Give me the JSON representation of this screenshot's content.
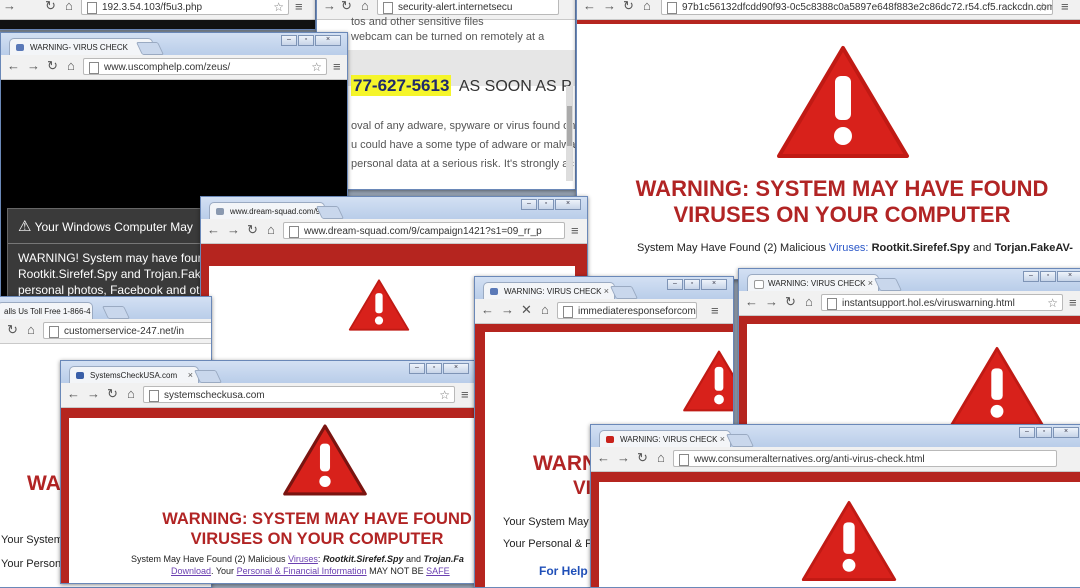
{
  "window_a": {
    "tab": "",
    "address": "192.3.54.103/f5u3.php"
  },
  "window_b": {
    "address": "security-alert.internetsecu",
    "body_lines": [
      "tos and other sensitive files",
      "webcam can be turned on remotely at a"
    ],
    "phone": "77-627-5613",
    "phone_suffix": "AS SOON AS P",
    "para": [
      "oval of any adware, spyware or virus found on",
      "u could have a some type of adware or malwa",
      "personal data at a serious risk. It's strongly ac"
    ]
  },
  "window_c": {
    "address": "97b1c56132dfcdd90f93-0c5c8388c0a5897e648f883e2c86dc72.r54.cf5.rackcdn.com",
    "warning_line1": "WARNING: SYSTEM MAY HAVE FOUND",
    "warning_line2": "VIRUSES ON YOUR COMPUTER",
    "sub_prefix": "System May Have Found (2) Malicious ",
    "sub_link": "Viruses:",
    "sub_b1": "Rootkit.Sirefef.Spy",
    "sub_and": " and ",
    "sub_b2": "Torjan.FakeAV-"
  },
  "window_d": {
    "tab": "WARNING- VIRUS CHECK",
    "address": "www.uscomphelp.com/zeus/",
    "dialog_title": "Your Windows Computer May",
    "dialog_lines": [
      "WARNING! System may have four",
      "Rootkit.Sirefef.Spy and Trojan.Fake",
      "personal photos, Facebook and oth"
    ]
  },
  "window_e": {
    "tab": "www.dream-squad.com/9",
    "address": "www.dream-squad.com/9/campaign1421?s1=09_rr_p"
  },
  "window_f": {
    "tab": "alls Us Toll Free 1-866-4",
    "address": "customerservice-247.net/in",
    "wa": "WA",
    "lines": [
      "Your System",
      "Your Person"
    ]
  },
  "window_g": {
    "tab": "SystemsCheckUSA.com",
    "address": "systemscheckusa.com",
    "warning_line1": "WARNING: SYSTEM MAY HAVE FOUND",
    "warning_line2": "VIRUSES ON YOUR COMPUTER",
    "sub_prefix": "System May Have Found (2) Malicious ",
    "sub_link": "Viruses",
    "sub_colon": ": ",
    "sub_b1": "Rootkit.Sirefef.Spy",
    "sub_and": " and ",
    "sub_b2": "Trojan.Fa",
    "sub2_link1": "Download",
    "sub2_mid": ". Your ",
    "sub2_link2": "Personal & Financial Information",
    "sub2_mid2": " MAY NOT BE ",
    "sub2_link3": "SAFE"
  },
  "window_h": {
    "tab": "WARNING: VIRUS CHECK",
    "address": "immediateresponseforcom",
    "warn": "WARN",
    "vi": "VI",
    "lines": [
      "Your System May I",
      "Your Personal & Fi"
    ],
    "help": "For Help"
  },
  "window_i": {
    "tab": "WARNING: VIRUS CHECK",
    "address": "instantsupport.hol.es/viruswarning.html"
  },
  "window_j": {
    "tab": "WARNING: VIRUS CHECK",
    "address": "www.consumeralternatives.org/anti-virus-check.html"
  },
  "colors": {
    "warning_red": "#b12424",
    "frame_red": "#b5251f",
    "triangle_red": "#d8211b"
  },
  "icons": [
    "back-arrow-icon",
    "forward-arrow-icon",
    "reload-icon",
    "stop-icon",
    "home-icon",
    "star-icon",
    "menu-icon",
    "warning-triangle-icon"
  ]
}
